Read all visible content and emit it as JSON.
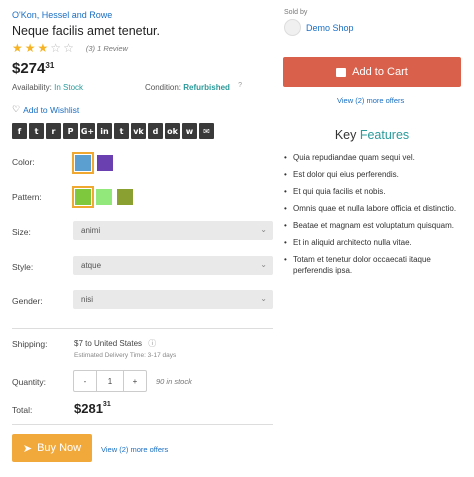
{
  "product": {
    "brand": "O'Kon, Hessel and Rowe",
    "title": "Neque facilis amet tenetur.",
    "rating": 3,
    "rating_max": 5,
    "reviews_label": "(3) 1 Review",
    "price_main": "$274",
    "price_cents": "31",
    "availability_label": "Availability:",
    "availability_value": "In Stock",
    "condition_label": "Condition:",
    "condition_value": "Refurbished",
    "wishlist_label": "Add to Wishlist"
  },
  "social": [
    {
      "icon": "facebook-icon",
      "glyph": "f"
    },
    {
      "icon": "twitter-icon",
      "glyph": "t"
    },
    {
      "icon": "reddit-icon",
      "glyph": "r"
    },
    {
      "icon": "pinterest-icon",
      "glyph": "P"
    },
    {
      "icon": "google-plus-icon",
      "glyph": "G+"
    },
    {
      "icon": "linkedin-icon",
      "glyph": "in"
    },
    {
      "icon": "tumblr-icon",
      "glyph": "t"
    },
    {
      "icon": "vk-icon",
      "glyph": "vk"
    },
    {
      "icon": "digg-icon",
      "glyph": "d"
    },
    {
      "icon": "odnoklassniki-icon",
      "glyph": "ok"
    },
    {
      "icon": "whatsapp-icon",
      "glyph": "w"
    },
    {
      "icon": "email-icon",
      "glyph": "✉"
    }
  ],
  "options": {
    "color_label": "Color:",
    "colors": [
      "#5a9fcf",
      "#6a3fb0"
    ],
    "pattern_label": "Pattern:",
    "patterns": [
      "#7ec83e",
      "#92e87a",
      "#8aa030"
    ],
    "size_label": "Size:",
    "size_value": "animi",
    "style_label": "Style:",
    "style_value": "atque",
    "gender_label": "Gender:",
    "gender_value": "nisi"
  },
  "shipping": {
    "label": "Shipping:",
    "value": "$7 to United States",
    "delivery": "Estimated Delivery Time: 3-17 days"
  },
  "quantity": {
    "label": "Quantity:",
    "minus": "-",
    "value": "1",
    "plus": "+",
    "stock": "90 in stock"
  },
  "total": {
    "label": "Total:",
    "main": "$281",
    "cents": "31"
  },
  "buy_now": {
    "label": "Buy Now",
    "offers": "View (2) more offers"
  },
  "seller": {
    "sold_by": "Sold by",
    "shop_name": "Demo Shop"
  },
  "cart": {
    "label": "Add to Cart",
    "offers": "View (2) more offers"
  },
  "key_features": {
    "title_a": "Key",
    "title_b": "Features",
    "items": [
      "Quia repudiandae quam sequi vel.",
      "Est dolor qui eius perferendis.",
      "Et qui quia facilis et nobis.",
      "Omnis quae et nulla labore officia et distinctio.",
      "Beatae et magnam est voluptatum quisquam.",
      "Et in aliquid architecto nulla vitae.",
      "Totam et tenetur dolor occaecati itaque perferendis ipsa."
    ]
  }
}
